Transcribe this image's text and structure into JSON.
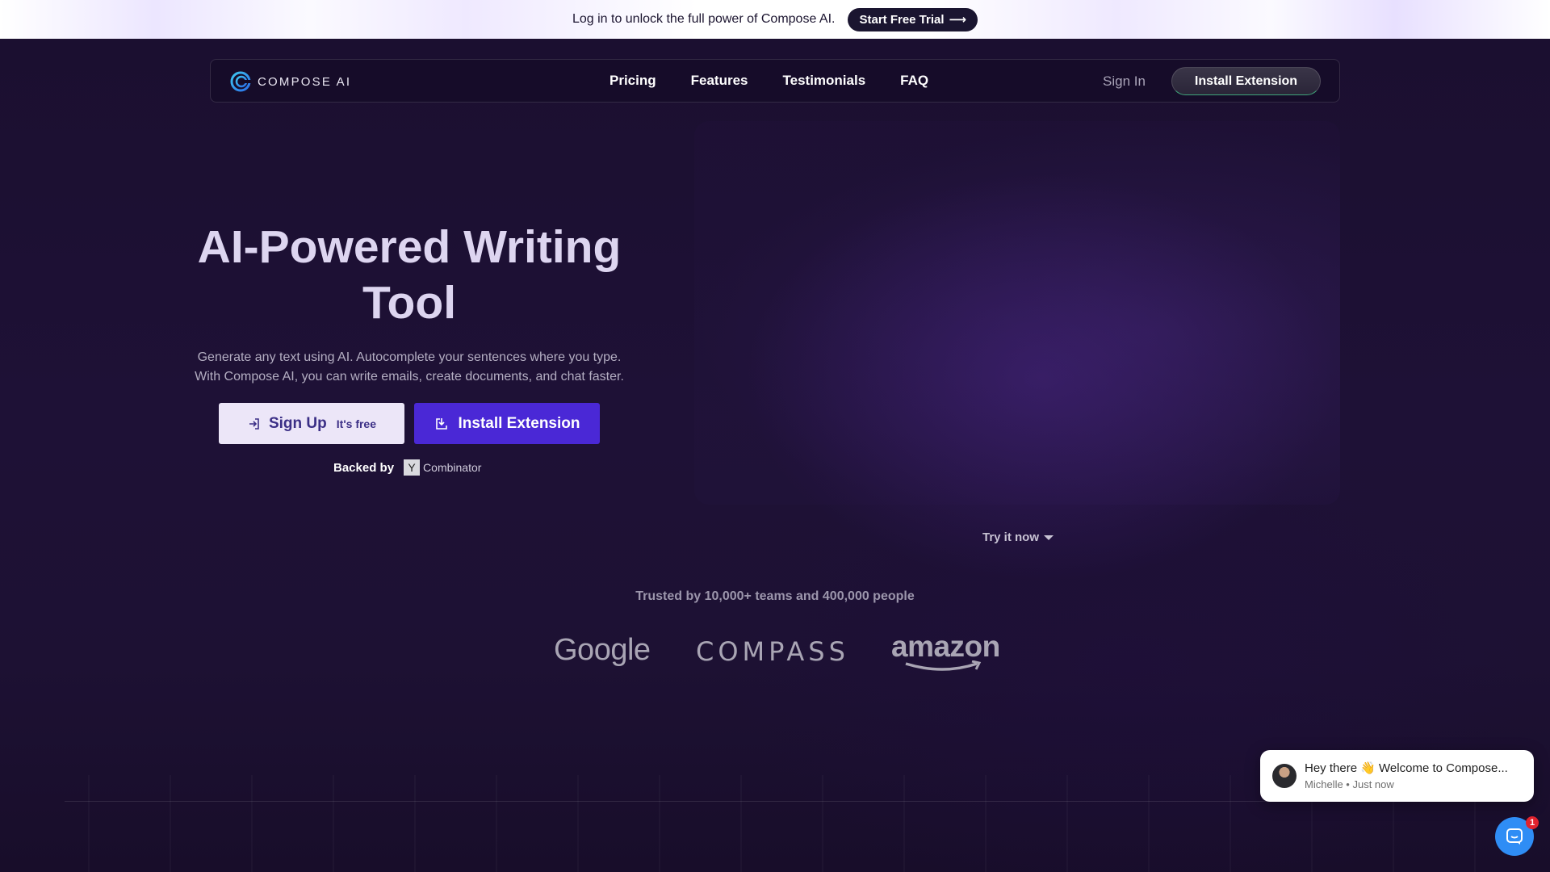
{
  "banner": {
    "text": "Log in to unlock the full power of Compose AI.",
    "cta_label": "Start Free Trial",
    "cta_arrow": "⟶"
  },
  "nav": {
    "logo_text": "COMPOSE AI",
    "links": [
      "Pricing",
      "Features",
      "Testimonials",
      "FAQ"
    ],
    "sign_in": "Sign In",
    "install": "Install Extension"
  },
  "hero": {
    "title_line1": "AI-Powered Writing",
    "title_line2": "Tool",
    "desc_line1": "Generate any text using AI. Autocomplete your sentences where you type.",
    "desc_line2": "With Compose AI, you can write emails, create documents, and chat faster.",
    "signup_label": "Sign Up",
    "signup_sub": "It's free",
    "install_label": "Install Extension",
    "backed_by": "Backed by",
    "yc_letter": "Y",
    "yc_text": "Combinator"
  },
  "try_now": "Try it now",
  "trusted": {
    "text": "Trusted by 10,000+ teams and 400,000 people",
    "logos": [
      "Google",
      "COMPASS",
      "amazon"
    ]
  },
  "chat": {
    "message": "Hey there 👋 Welcome to Compose...",
    "sender": "Michelle",
    "time": "Just now",
    "meta": "Michelle • Just now",
    "badge_count": "1"
  },
  "colors": {
    "background": "#1b0f30",
    "primary_button": "#4a28d6",
    "secondary_button": "#ece6f8",
    "title": "#ddd5f0",
    "chat_launcher": "#2f8df5",
    "badge": "#e0232e"
  },
  "icons": {
    "signup": "sign-in-arrow-icon",
    "install": "download-box-icon",
    "try_now": "caret-down-icon",
    "logo": "compose-swirl-logo",
    "launcher": "chat-icon"
  }
}
